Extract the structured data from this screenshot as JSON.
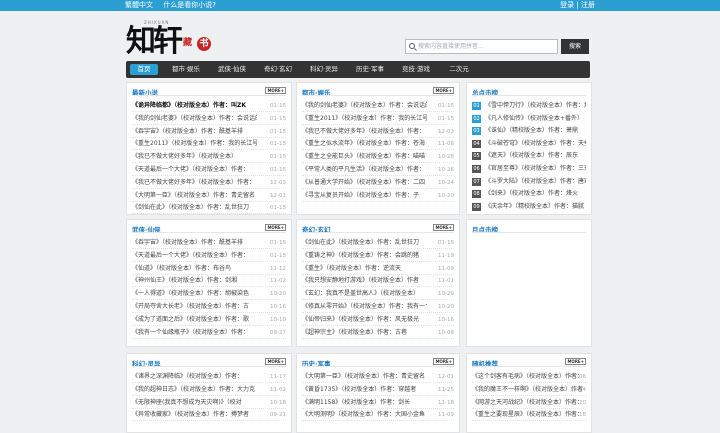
{
  "topbar": {
    "simplified": "繁體中文",
    "question": "什么是看你小说?",
    "login": "登录",
    "separator": "|",
    "register": "注册"
  },
  "logo": {
    "text": "知轩",
    "seal_a": "藏",
    "seal_b": "书",
    "sub": "ZHIXUAN"
  },
  "search": {
    "placeholder": "搜索内容直接使用拼音...",
    "button": "搜索"
  },
  "nav": {
    "items": [
      "首页",
      "都市·娱乐",
      "武侠·仙侠",
      "奇幻·玄幻",
      "科幻·灵异",
      "历史·军事",
      "竞技·游戏",
      "二次元"
    ]
  },
  "more_label": "MORE+",
  "panels": {
    "latest": {
      "title": "最新小说",
      "rows": [
        {
          "t": "《诡异降临都》（校对版全本）作者：叫ZK",
          "d": "01-15",
          "bold": true
        },
        {
          "t": "《我的剑仙老婆》（校对版全本）作者：会说话的肘子",
          "d": "01-15"
        },
        {
          "t": "《吞宇宙》（校对版全本）作者：酰基羊排",
          "d": "01-15"
        },
        {
          "t": "《重生2011》（校对版全本）作者：我的长江号",
          "d": "01-15"
        },
        {
          "t": "《我已不做大佬好多年》（校对版全本）",
          "d": "01-15"
        },
        {
          "t": "《天道最后一个大佬》（校对版全本）作者：",
          "d": "01-15"
        },
        {
          "t": "《我已不做大佬好多年》（校对版全本）作者：",
          "d": "12-03"
        },
        {
          "t": "《大明第一臣》（校对版全本）作者：青史留名",
          "d": "12-01"
        },
        {
          "t": "《剑仙在此》（校对版全本）作者：乱世狂刀",
          "d": "01-15"
        }
      ]
    },
    "urban": {
      "title": "都市·娱乐",
      "rows": [
        {
          "t": "《我的剑仙老婆》（校对版全本）作者：会说话的肘子",
          "d": "01-15"
        },
        {
          "t": "《重生2011》（校对版全本）作者：我的长江号",
          "d": "01-15"
        },
        {
          "t": "《我已不做大佬好多年》（校对版全本）作者：",
          "d": "12-03"
        },
        {
          "t": "《重生之似水流年》（校对版全本）作者：苍海",
          "d": "11-08"
        },
        {
          "t": "《重生之全能巨头》（校对版全本）作者：喵喵",
          "d": "10-28"
        },
        {
          "t": "《平常人类的平凡生活》（校对版全本）作者：",
          "d": "10-26"
        },
        {
          "t": "《从普通大学开始》（校对版全本）作者：二四",
          "d": "10-24"
        },
        {
          "t": "《寻宝从复员开始》（校对版全本）作者：子",
          "d": "10-20"
        }
      ]
    },
    "total_rank": {
      "title": "总点击榜",
      "rows": [
        {
          "n": "01",
          "t": "《雪中悍刀行》（校对版全本）作者：烽火"
        },
        {
          "n": "02",
          "t": "《凡人修仙传》（校对版全本+番外）"
        },
        {
          "n": "03",
          "t": "《诛仙》（精校版全本）作者：萧鼎"
        },
        {
          "n": "04",
          "t": "《斗破苍穹》（校对版全本）作者：天蚕"
        },
        {
          "n": "05",
          "t": "《遮天》（校对版全本）作者：辰东"
        },
        {
          "n": "06",
          "t": "《官居至尊》（校对版全本）作者：三戒"
        },
        {
          "n": "07",
          "t": "《斗罗大陆》（校对版全本）作者：唐家"
        },
        {
          "n": "08",
          "t": "《剑来》（校对版全本）作者：烽火"
        },
        {
          "n": "09",
          "t": "《庆余年》（精校版全本）作者：猫腻"
        }
      ]
    },
    "wuxia": {
      "title": "武侠·仙侠",
      "rows": [
        {
          "t": "《吞宇宙》（校对版全本）作者：酰基羊排",
          "d": "01-15"
        },
        {
          "t": "《天道最后一个大佬》（校对版全本）作者：",
          "d": "01-15"
        },
        {
          "t": "《仙道》（校对版全本）作者：布谷鸟",
          "d": "11-12"
        },
        {
          "t": "《神州仙王》（校对版全本）作者：剑湘",
          "d": "11-02"
        },
        {
          "t": "《一人得道》（校对版全本）作者：胡椒染色",
          "d": "10-20"
        },
        {
          "t": "《开局夺舍大长老》（校对版全本）作者：古",
          "d": "10-16"
        },
        {
          "t": "《成为了道面之后》（校对版全本）作者：歌",
          "d": "10-10"
        },
        {
          "t": "《我有一个仙缘瓶子》（校对版全本）作者：",
          "d": "09-27"
        }
      ]
    },
    "fantasy": {
      "title": "奇幻·玄幻",
      "rows": [
        {
          "t": "《剑仙在此》（校对版全本）作者：乱世狂刀",
          "d": "01-15"
        },
        {
          "t": "《重铸之神》（校对版全本）作者：会跳的猪",
          "d": "11-19"
        },
        {
          "t": "《重生》（校对版全本）作者：逆流天",
          "d": "11-09"
        },
        {
          "t": "《我只想安静地打游戏》（校对版全本）作者",
          "d": "11-01"
        },
        {
          "t": "《玄幻：我真不是盖世高人》（校对版全本）",
          "d": "10-29"
        },
        {
          "t": "《修真从零开始》（校对版全本）作者：我有一个",
          "d": "10-20"
        },
        {
          "t": "《仙帝归来》（校对版全本）作者：风无极光",
          "d": "10-16"
        },
        {
          "t": "《超神宗主》（校对版全本）作者：古巷",
          "d": "10-08"
        }
      ]
    },
    "monthly_rank": {
      "title": "月点击榜",
      "rows": []
    },
    "scifi": {
      "title": "科幻·灵异",
      "rows": [
        {
          "t": "《诸界之深渊降临》（校对版全本）作者：",
          "d": "11-17"
        },
        {
          "t": "《我的超神日志》（校对版全本）作者：大力克",
          "d": "11-02"
        },
        {
          "t": "《无限神座(我真不想成为天灾啊)》（校对",
          "d": "10-18"
        },
        {
          "t": "《异常收藏家》（校对版全本）作者：搏梦者",
          "d": "09-21"
        }
      ]
    },
    "history": {
      "title": "历史·军事",
      "rows": [
        {
          "t": "《大明第一臣》（校对版全本）作者：青史留名",
          "d": "12-01"
        },
        {
          "t": "《黄昏1735》（校对版全本）作者：穿越者",
          "d": "11-25"
        },
        {
          "t": "《满明1158》（校对版全本）作者：剑长",
          "d": "11-18"
        },
        {
          "t": "《大明测明》（校对版全本）作者：大国小金鱼",
          "d": "11-09"
        }
      ]
    },
    "random": {
      "title": "随机推荐",
      "rows": [
        {
          "t": "《这个剑客有毛病》（校对版全本）作者：",
          "d": "01-06"
        },
        {
          "t": "《我的魔王不一样啊》（校对版全本）作者",
          "d": "11-24"
        },
        {
          "t": "《网游之天河战纪》（校对版全本）作者：",
          "d": "11-20"
        },
        {
          "t": "《重生之要现星辰》（校对版全本）作者：",
          "d": "01-18"
        }
      ]
    }
  },
  "colors": {
    "accent": "#2c9fd2",
    "nav_bg": "#333333",
    "title_blue": "#1a78c2"
  }
}
